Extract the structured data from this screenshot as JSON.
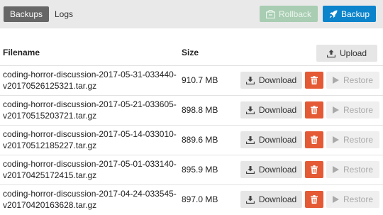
{
  "nav": {
    "backups_label": "Backups",
    "logs_label": "Logs",
    "rollback_label": "Rollback",
    "backup_label": "Backup"
  },
  "table": {
    "col_filename": "Filename",
    "col_size": "Size",
    "upload_label": "Upload",
    "download_label": "Download",
    "restore_label": "Restore",
    "rows": [
      {
        "filename": "coding-horror-discussion-2017-05-31-033440-v20170526125321.tar.gz",
        "size": "910.7 MB"
      },
      {
        "filename": "coding-horror-discussion-2017-05-21-033605-v20170515203721.tar.gz",
        "size": "898.8 MB"
      },
      {
        "filename": "coding-horror-discussion-2017-05-14-033010-v20170512185227.tar.gz",
        "size": "889.6 MB"
      },
      {
        "filename": "coding-horror-discussion-2017-05-01-033140-v20170425172415.tar.gz",
        "size": "895.9 MB"
      },
      {
        "filename": "coding-horror-discussion-2017-04-24-033545-v20170420163628.tar.gz",
        "size": "897.0 MB"
      }
    ]
  },
  "icons": {
    "rollback": "rollback-icon",
    "backup": "rocket-icon",
    "upload": "upload-icon",
    "download": "download-icon",
    "delete": "trash-icon",
    "restore": "play-icon"
  },
  "colors": {
    "topbar_bg": "#e9e9e9",
    "active_tab": "#666666",
    "rollback_disabled": "#a8cdb2",
    "backup_primary": "#0b84cc",
    "delete_danger": "#e45a35"
  }
}
